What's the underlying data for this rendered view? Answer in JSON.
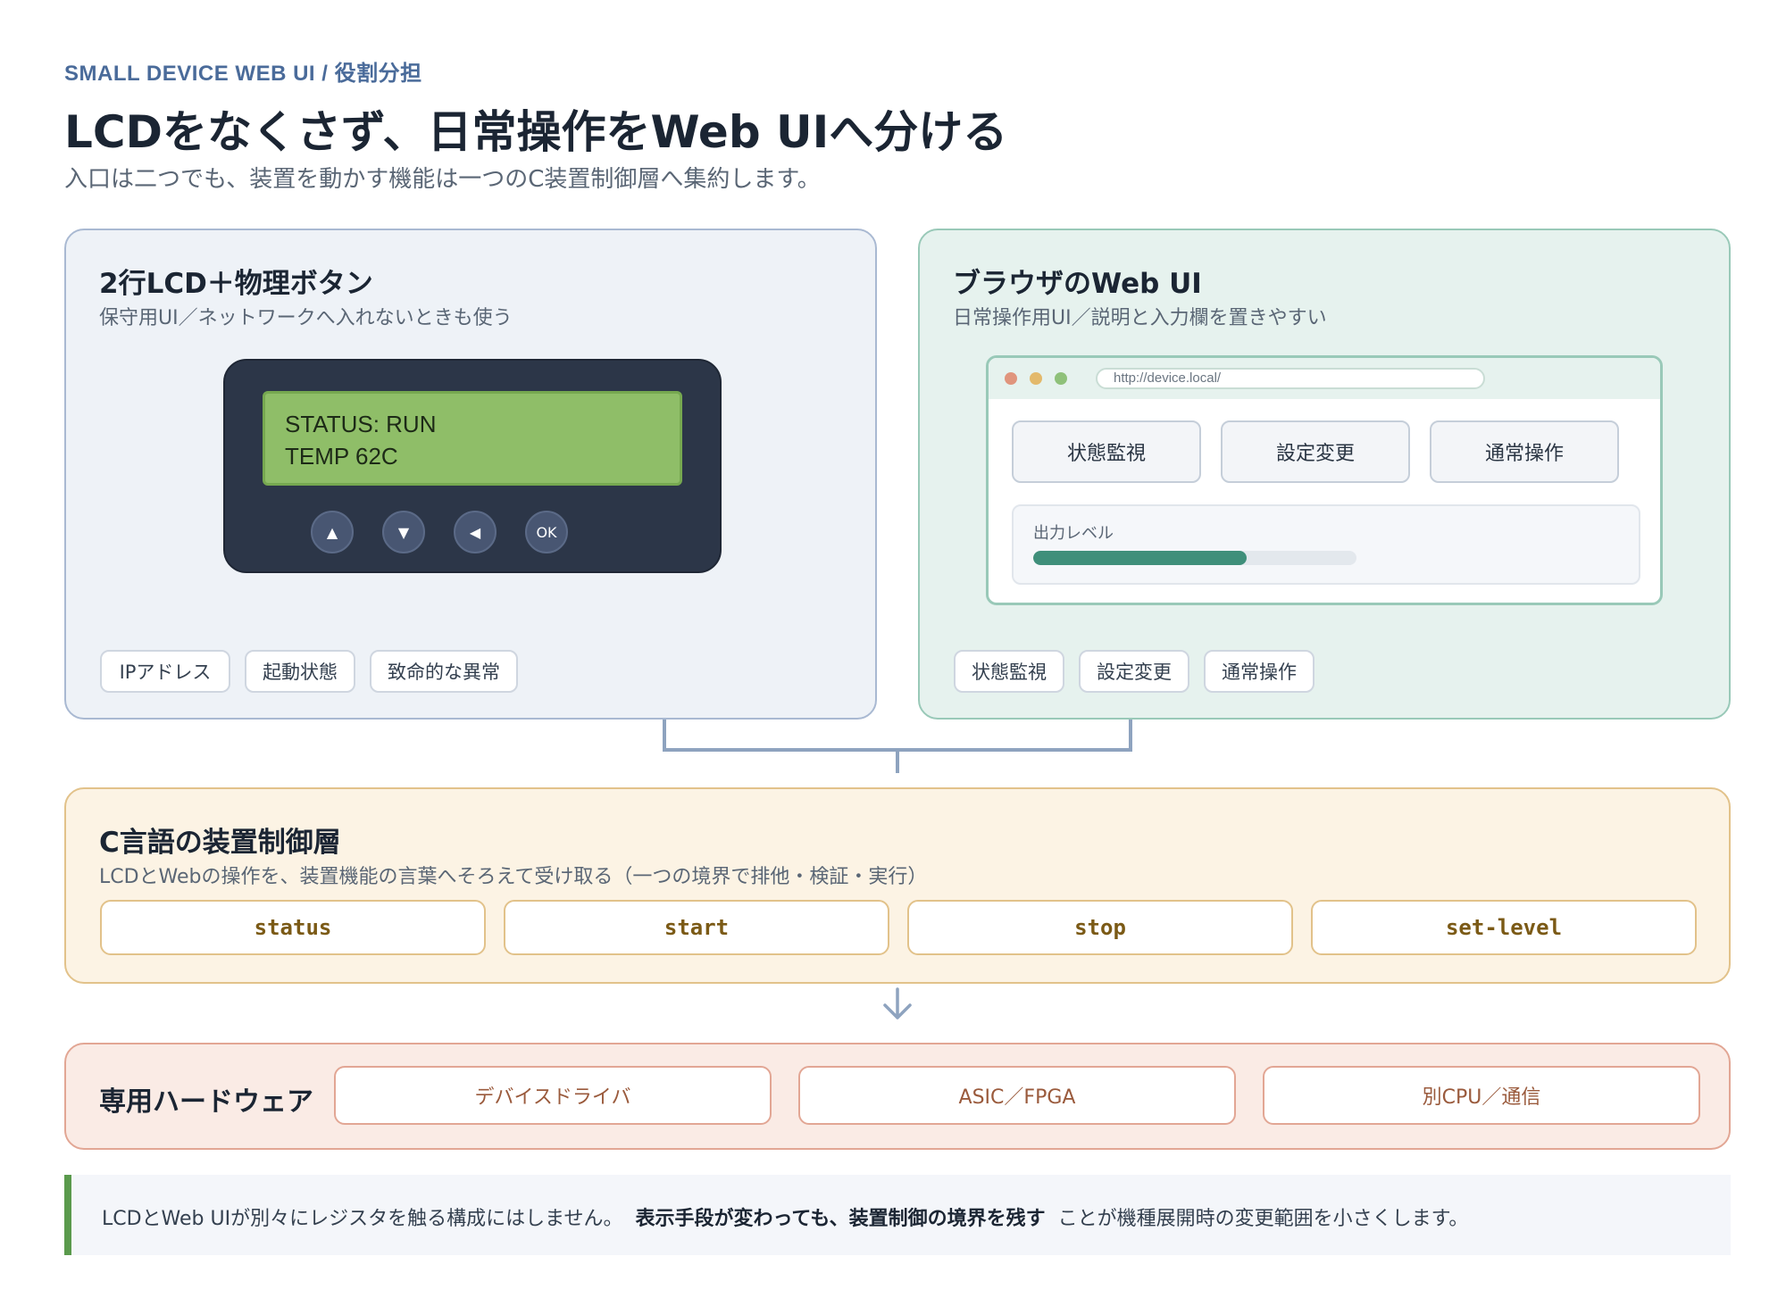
{
  "header": {
    "eyebrow": "SMALL DEVICE WEB UI / 役割分担",
    "title": "LCDをなくさず、日常操作をWeb UIへ分ける",
    "subtitle": "入口は二つでも、装置を動かす機能は一つのC装置制御層へ集約します。"
  },
  "lcd_panel": {
    "title": "2行LCD＋物理ボタン",
    "subtitle": "保守用UI／ネットワークへ入れないときも使う",
    "screen_line1": "STATUS: RUN",
    "screen_line2": "TEMP 62C",
    "buttons": [
      "▲",
      "▼",
      "◀",
      "OK"
    ],
    "chips": [
      "IPアドレス",
      "起動状態",
      "致命的な異常"
    ]
  },
  "web_panel": {
    "title": "ブラウザのWeb UI",
    "subtitle": "日常操作用UI／説明と入力欄を置きやすい",
    "url": "http://device.local/",
    "tabs": [
      "状態監視",
      "設定変更",
      "通常操作"
    ],
    "level_label": "出力レベル",
    "level_fraction": 0.66,
    "chips": [
      "状態監視",
      "設定変更",
      "通常操作"
    ]
  },
  "control_layer": {
    "title": "C言語の装置制御層",
    "subtitle": "LCDとWebの操作を、装置機能の言葉へそろえて受け取る（一つの境界で排他・検証・実行）",
    "commands": [
      "status",
      "start",
      "stop",
      "set-level"
    ]
  },
  "hardware": {
    "title": "専用ハードウェア",
    "items": [
      "デバイスドライバ",
      "ASIC／FPGA",
      "別CPU／通信"
    ]
  },
  "note": {
    "text_before": "LCDとWeb UIが別々にレジスタを触る構成にはしません。",
    "emphasis": "表示手段が変わっても、装置制御の境界を残す",
    "text_after": "ことが機種展開時の変更範囲を小さくします。"
  },
  "colors": {
    "lcd_panel_bg": "#eef2f7",
    "web_panel_bg": "#e6f2ee",
    "control_bg": "#fcf3e4",
    "hardware_bg": "#faebe5",
    "accent_green": "#3f8f7a",
    "note_bar": "#5a9a4c"
  }
}
